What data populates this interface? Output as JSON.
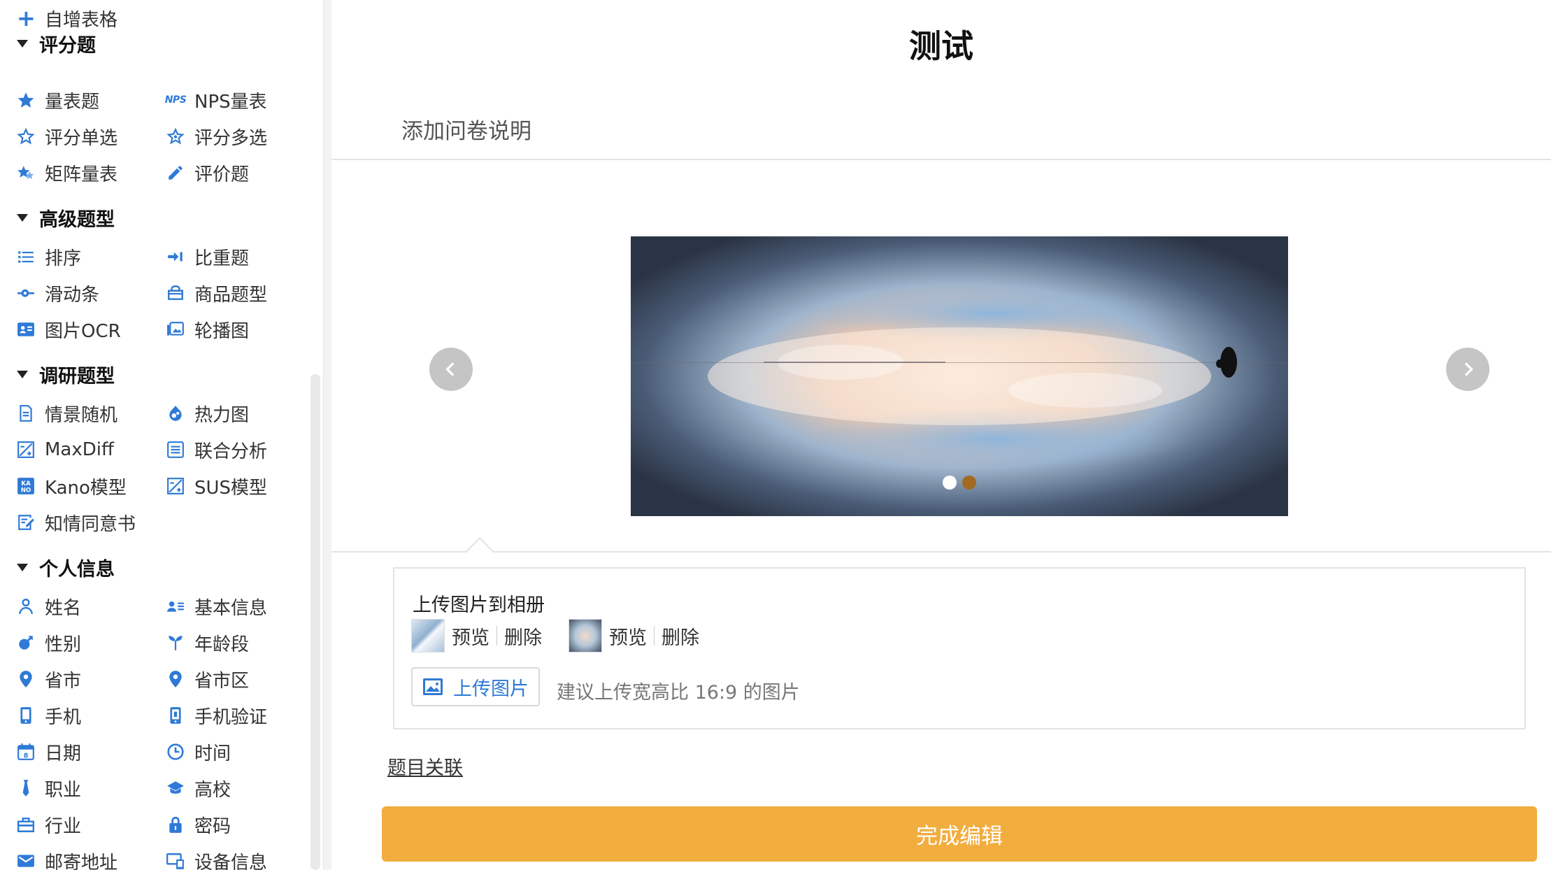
{
  "sidebar": {
    "add_table_label": "自增表格",
    "sections": [
      {
        "title": "评分题",
        "items": [
          {
            "label": "量表题",
            "icon": "star-filled-icon"
          },
          {
            "label": "NPS量表",
            "icon": "nps-icon",
            "icon_text": "NPS"
          },
          {
            "label": "评分单选",
            "icon": "star-outline-icon"
          },
          {
            "label": "评分多选",
            "icon": "star-outline-icon"
          },
          {
            "label": "矩阵量表",
            "icon": "star-half-icon"
          },
          {
            "label": "评价题",
            "icon": "pencil-icon"
          }
        ]
      },
      {
        "title": "高级题型",
        "items": [
          {
            "label": "排序",
            "icon": "list-icon"
          },
          {
            "label": "比重题",
            "icon": "weight-icon"
          },
          {
            "label": "滑动条",
            "icon": "slider-icon"
          },
          {
            "label": "商品题型",
            "icon": "shop-icon"
          },
          {
            "label": "图片OCR",
            "icon": "id-card-icon"
          },
          {
            "label": "轮播图",
            "icon": "carousel-icon"
          }
        ]
      },
      {
        "title": "调研题型",
        "items": [
          {
            "label": "情景随机",
            "icon": "document-icon"
          },
          {
            "label": "热力图",
            "icon": "heatmap-icon"
          },
          {
            "label": "MaxDiff",
            "icon": "maxdiff-icon"
          },
          {
            "label": "联合分析",
            "icon": "conjoint-icon"
          },
          {
            "label": "Kano模型",
            "icon": "kano-icon"
          },
          {
            "label": "SUS模型",
            "icon": "sus-icon"
          },
          {
            "label": "知情同意书",
            "icon": "consent-icon"
          }
        ]
      },
      {
        "title": "个人信息",
        "items": [
          {
            "label": "姓名",
            "icon": "person-icon"
          },
          {
            "label": "基本信息",
            "icon": "contact-list-icon"
          },
          {
            "label": "性别",
            "icon": "gender-icon"
          },
          {
            "label": "年龄段",
            "icon": "age-icon"
          },
          {
            "label": "省市",
            "icon": "location-pin-icon"
          },
          {
            "label": "省市区",
            "icon": "location-pin-icon"
          },
          {
            "label": "手机",
            "icon": "phone-icon"
          },
          {
            "label": "手机验证",
            "icon": "phone-verify-icon"
          },
          {
            "label": "日期",
            "icon": "calendar-icon"
          },
          {
            "label": "时间",
            "icon": "clock-icon"
          },
          {
            "label": "职业",
            "icon": "tie-icon"
          },
          {
            "label": "高校",
            "icon": "graduation-cap-icon"
          },
          {
            "label": "行业",
            "icon": "briefcase-icon"
          },
          {
            "label": "密码",
            "icon": "lock-icon"
          },
          {
            "label": "邮寄地址",
            "icon": "mail-icon"
          },
          {
            "label": "设备信息",
            "icon": "device-icon"
          }
        ]
      }
    ]
  },
  "main": {
    "title": "测试",
    "description": "添加问卷说明",
    "carousel": {
      "slide_count": 2,
      "active_index": 1
    },
    "upload": {
      "title": "上传图片到相册",
      "images": [
        {
          "preview_label": "预览",
          "delete_label": "删除"
        },
        {
          "preview_label": "预览",
          "delete_label": "删除"
        }
      ],
      "button_label": "上传图片",
      "hint": "建议上传宽高比 16:9 的图片"
    },
    "related_link": "题目关联",
    "finish_button": "完成编辑"
  },
  "colors": {
    "accent": "#2f7ad6",
    "finish_button": "#f2ad3f",
    "active_dot": "#a36a22"
  }
}
